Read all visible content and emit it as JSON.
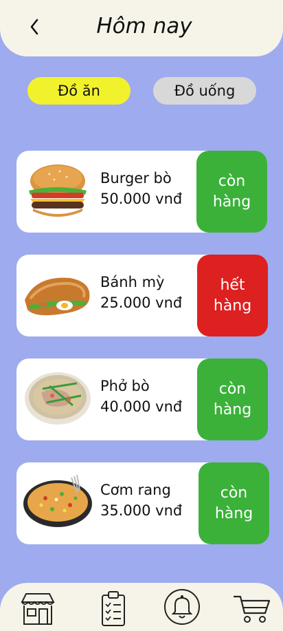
{
  "header": {
    "title": "Hôm nay",
    "back_icon": "chevron-left-icon"
  },
  "tabs": [
    {
      "label": "Đồ ăn",
      "active": true,
      "color": "#f2f22c"
    },
    {
      "label": "Đồ uống",
      "active": false,
      "color": "#d8d8d8"
    }
  ],
  "items": [
    {
      "name": "Burger bò",
      "price": "50.000 vnđ",
      "status_line1": "còn",
      "status_line2": "hàng",
      "in_stock": true,
      "image_icon": "burger-image"
    },
    {
      "name": "Bánh mỳ",
      "price": "25.000 vnđ",
      "status_line1": "hết",
      "status_line2": "hàng",
      "in_stock": false,
      "image_icon": "banh-mi-image"
    },
    {
      "name": "Phở bò",
      "price": "40.000 vnđ",
      "status_line1": "còn",
      "status_line2": "hàng",
      "in_stock": true,
      "image_icon": "pho-image"
    },
    {
      "name": "Cơm rang",
      "price": "35.000 vnđ",
      "status_line1": "còn",
      "status_line2": "hàng",
      "in_stock": true,
      "image_icon": "com-rang-image"
    }
  ],
  "bottom_nav": [
    "store-icon",
    "clipboard-icon",
    "bell-icon",
    "cart-icon"
  ],
  "colors": {
    "background": "#9eabee",
    "header": "#f6f4e8",
    "in_stock": "#3bb13a",
    "out_of_stock": "#dd2020"
  }
}
